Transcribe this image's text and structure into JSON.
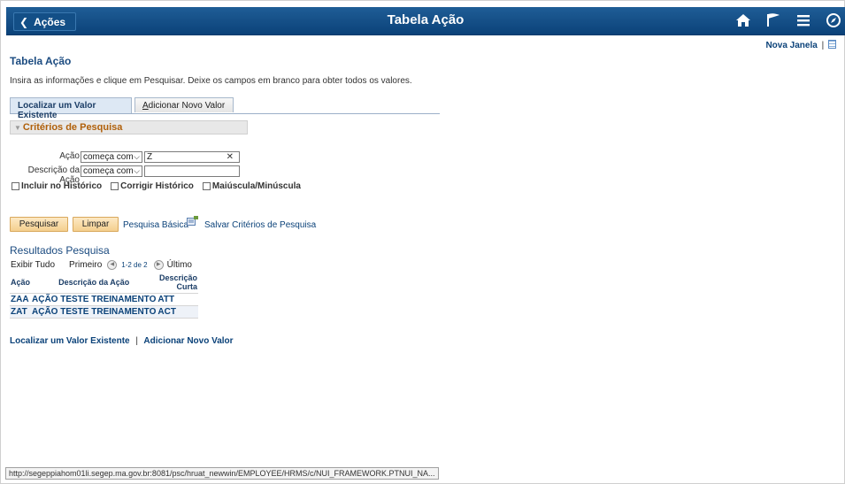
{
  "header": {
    "back_label": "Ações",
    "title": "Tabela Ação",
    "icons": [
      "home-icon",
      "flag-icon",
      "menu-icon",
      "navbar-icon"
    ]
  },
  "top_links": {
    "new_window": "Nova Janela",
    "separator": "|"
  },
  "page": {
    "title": "Tabela Ação",
    "instructions": "Insira as informações e clique em Pesquisar. Deixe os campos em branco para obter todos os valores."
  },
  "tabs": [
    {
      "label": "Localizar um Valor Existente",
      "active": true
    },
    {
      "label": "Adicionar Novo Valor",
      "accesskey_letter": "A",
      "rest": "dicionar Novo Valor",
      "active": false
    }
  ],
  "criteria": {
    "header": "Critérios de Pesquisa",
    "fields": [
      {
        "label": "Ação",
        "operator": "começa com",
        "value": "Z"
      },
      {
        "label": "Descrição da Ação",
        "operator": "começa com",
        "value": ""
      }
    ],
    "checkboxes": [
      "Incluir no Histórico",
      "Corrigir Histórico",
      "Maiúscula/Minúscula"
    ]
  },
  "actions": {
    "search": "Pesquisar",
    "clear": "Limpar",
    "basic_search": "Pesquisa Básica",
    "save_criteria": "Salvar Critérios de Pesquisa"
  },
  "results": {
    "title": "Resultados Pesquisa",
    "view_all": "Exibir Tudo",
    "first": "Primeiro",
    "range": "1-2 de 2",
    "last": "Último",
    "columns": [
      "Ação",
      "Descrição da Ação",
      "Descrição Curta"
    ],
    "rows": [
      [
        "ZAA",
        "AÇÃO TESTE TREINAMENTO",
        "ATT"
      ],
      [
        "ZAT",
        "AÇÃO TESTE TREINAMENTO",
        "ACT"
      ]
    ]
  },
  "bottom_links": {
    "find": "Localizar um Valor Existente",
    "separator": "|",
    "add": "Adicionar Novo Valor"
  },
  "status_bar": {
    "url": "http://segeppiahom01li.segep.ma.gov.br:8081/psc/hruat_newwin/EMPLOYEE/HRMS/c/NUI_FRAMEWORK.PTNUI_NA..."
  },
  "colors": {
    "banner": "#0b4279",
    "accent_orange": "#b0600a",
    "link": "#0b4279",
    "button": "#f4cf8e"
  }
}
